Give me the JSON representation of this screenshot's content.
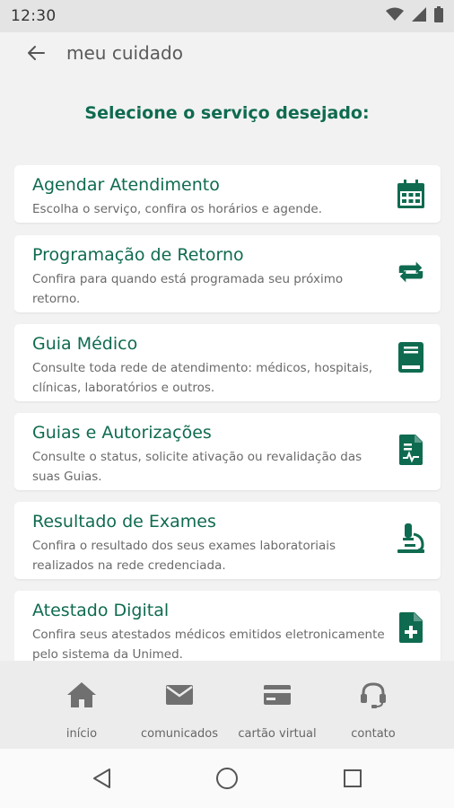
{
  "status_bar": {
    "time": "12:30",
    "icons": [
      "wifi-icon",
      "signal-icon",
      "battery-icon"
    ]
  },
  "app_bar": {
    "title": "meu cuidado",
    "back_icon": "back-arrow-icon"
  },
  "heading": "Selecione o serviço desejado:",
  "colors": {
    "accent": "#0f6b50",
    "background": "#f2f2f2",
    "card": "#ffffff",
    "nav_icon": "#707070"
  },
  "services": [
    {
      "title": "Agendar Atendimento",
      "description": "Escolha o serviço, confira os horários e agende.",
      "icon": "calendar-icon"
    },
    {
      "title": "Programação de Retorno",
      "description": "Confira para quando está programada seu próximo retorno.",
      "icon": "repeat-icon"
    },
    {
      "title": "Guia Médico",
      "description": "Consulte toda rede de atendimento: médicos, hospitais, clínicas, laboratórios e outros.",
      "icon": "book-icon"
    },
    {
      "title": "Guias e Autorizações",
      "description": "Consulte o status, solicite ativação ou revalidação das suas Guias.",
      "icon": "medical-document-icon"
    },
    {
      "title": "Resultado de Exames",
      "description": "Confira o resultado dos seus exames laboratoriais realizados na rede credenciada.",
      "icon": "microscope-icon"
    },
    {
      "title": "Atestado Digital",
      "description": "Confira seus atestados médicos emitidos eletronicamente pelo sistema da Unimed.",
      "icon": "file-plus-icon"
    }
  ],
  "bottom_nav": [
    {
      "label": "início",
      "icon": "home-icon"
    },
    {
      "label": "comunicados",
      "icon": "mail-icon"
    },
    {
      "label": "cartão virtual",
      "icon": "credit-card-icon"
    },
    {
      "label": "contato",
      "icon": "headset-icon"
    }
  ],
  "system_nav": [
    "back-triangle-icon",
    "home-circle-icon",
    "recents-square-icon"
  ]
}
